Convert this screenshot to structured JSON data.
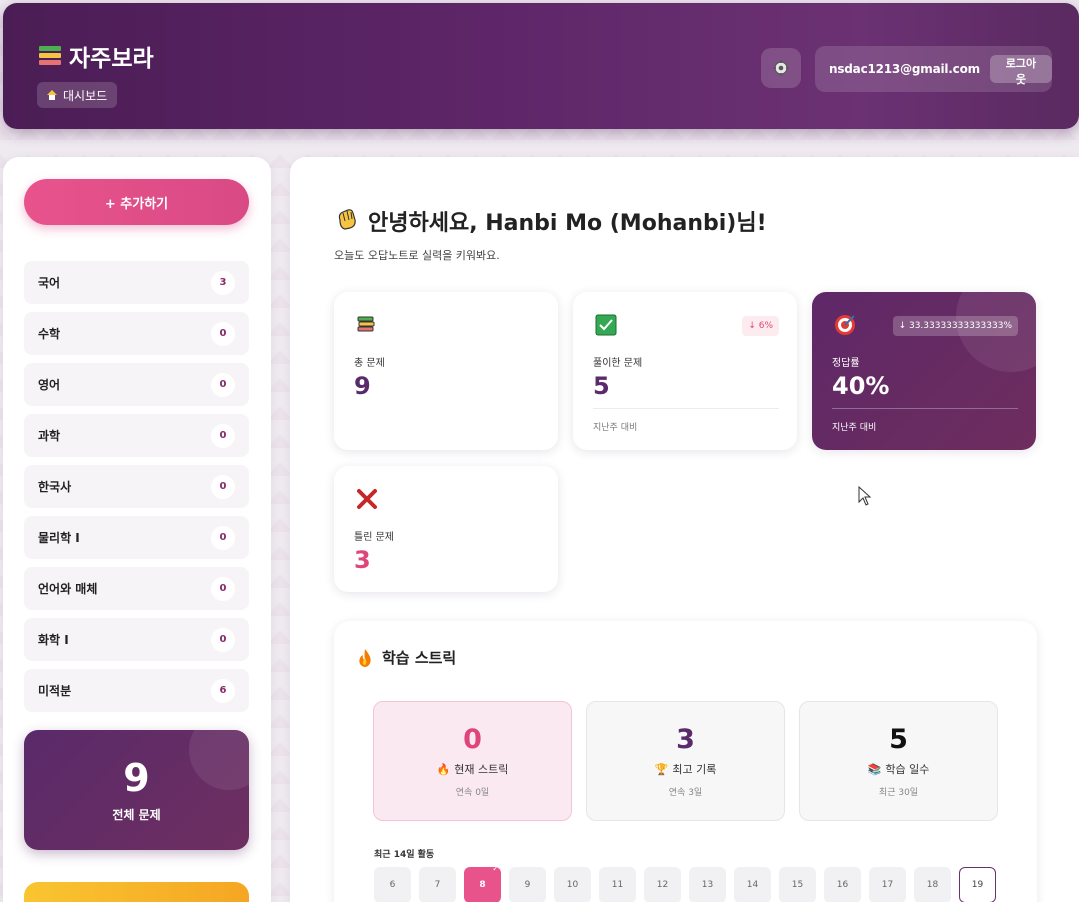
{
  "app": {
    "title": "자주보라",
    "breadcrumb": "대시보드"
  },
  "user": {
    "email": "nsdac1213@gmail.com",
    "logout_label": "로그아웃"
  },
  "sidebar": {
    "add_label": "+ 추가하기",
    "subjects": [
      {
        "name": "국어",
        "count": "3"
      },
      {
        "name": "수학",
        "count": "0"
      },
      {
        "name": "영어",
        "count": "0"
      },
      {
        "name": "과학",
        "count": "0"
      },
      {
        "name": "한국사",
        "count": "0"
      },
      {
        "name": "물리학 I",
        "count": "0"
      },
      {
        "name": "언어와 매체",
        "count": "0"
      },
      {
        "name": "화학 I",
        "count": "0"
      },
      {
        "name": "미적분",
        "count": "6"
      }
    ],
    "total_count": "9",
    "total_label": "전체 문제"
  },
  "main": {
    "greeting": "안녕하세요, Hanbi Mo (Mohanbi)님!",
    "subtitle": "오늘도 오답노트로 실력을 키워봐요.",
    "stats": {
      "total": {
        "label": "총 문제",
        "value": "9"
      },
      "solved": {
        "label": "풀이한 문제",
        "value": "5",
        "change": "↓ 6%",
        "footer": "지난주 대비"
      },
      "accuracy": {
        "label": "정답률",
        "value": "40%",
        "change": "↓ 33.33333333333333%",
        "footer": "지난주 대비"
      },
      "wrong": {
        "label": "틀린 문제",
        "value": "3"
      }
    },
    "streak": {
      "title": "학습 스트릭",
      "current": {
        "value": "0",
        "label": "현재 스트릭",
        "sub": "연속 0일"
      },
      "best": {
        "value": "3",
        "label": "최고 기록",
        "sub": "연속 3일"
      },
      "days_studied": {
        "value": "5",
        "label": "학습 일수",
        "sub": "최근 30일"
      },
      "recent_label": "최근 14일 활동",
      "days": [
        "6",
        "7",
        "8",
        "9",
        "10",
        "11",
        "12",
        "13",
        "14",
        "15",
        "16",
        "17",
        "18",
        "19"
      ]
    }
  },
  "colors": {
    "brand": "#5e2668",
    "accent": "#e8538c",
    "accuracy_card": "#6e2d5e"
  }
}
